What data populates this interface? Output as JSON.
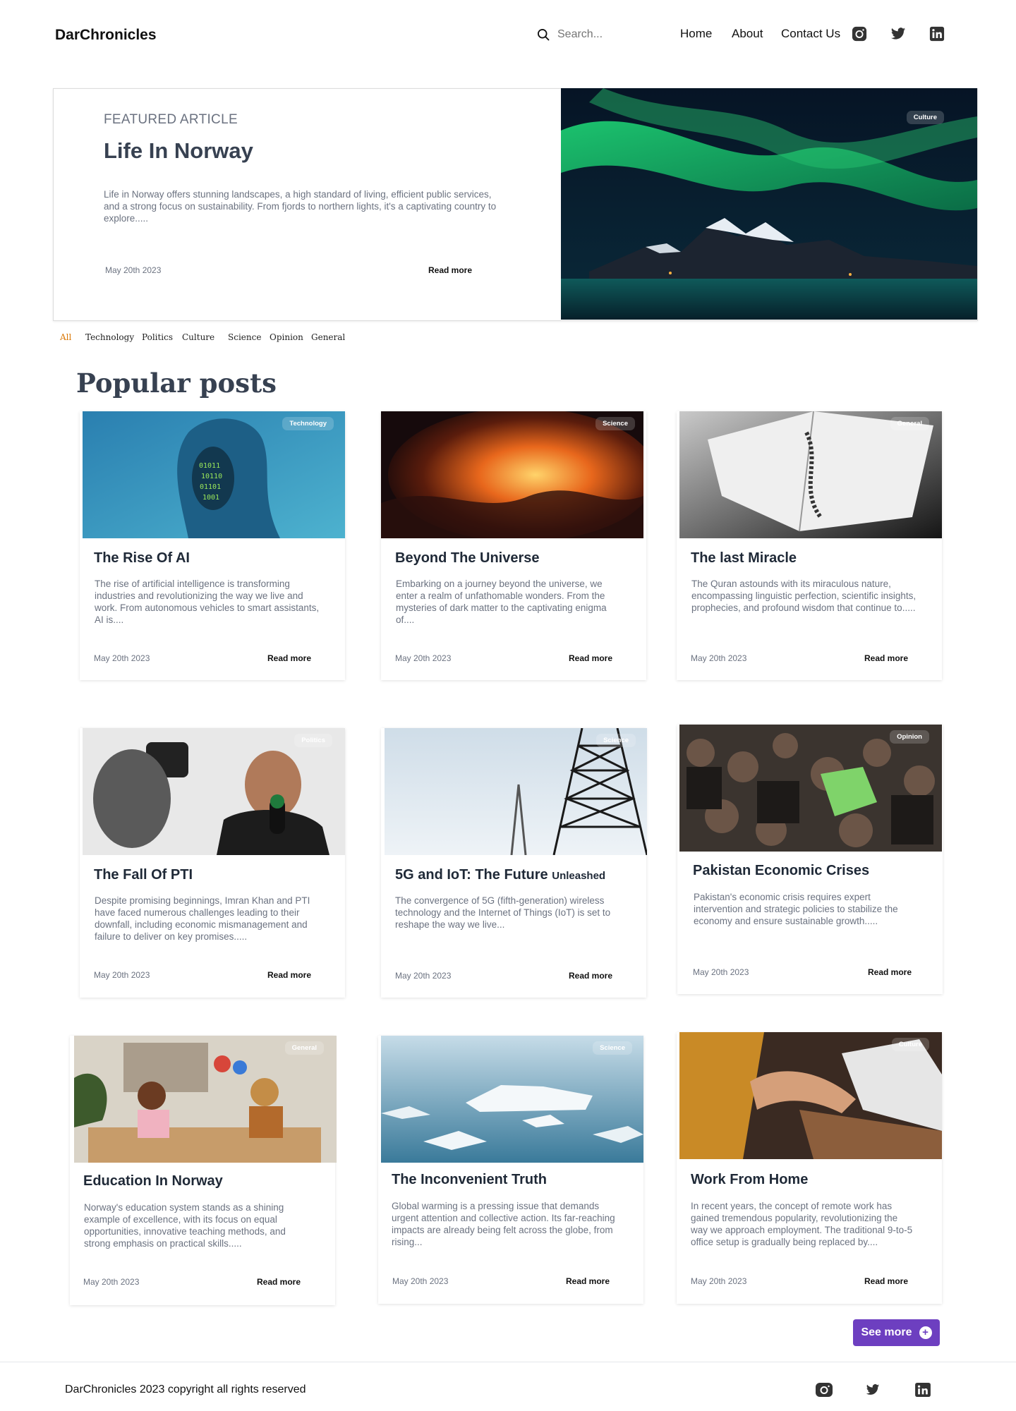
{
  "header": {
    "brand": "DarChronicles",
    "search_placeholder": "Search...",
    "nav": [
      "Home",
      "About",
      "Contact Us"
    ],
    "social_icons": [
      "instagram-icon",
      "twitter-icon",
      "linkedin-icon"
    ]
  },
  "featured": {
    "kicker": "FEATURED ARTICLE",
    "title": "Life In Norway",
    "description": "Life in Norway offers stunning landscapes, a high standard of living, efficient public services, and a strong focus on sustainability. From fjords to northern lights, it's a captivating country to explore.....",
    "date": "May 20th 2023",
    "read_more": "Read more",
    "badge": "Culture"
  },
  "categories": [
    "All",
    "Technology",
    "Politics",
    "Culture",
    "Science",
    "Opinion",
    "General"
  ],
  "active_category": "All",
  "section_title": "Popular posts",
  "posts": [
    {
      "badge": "Technology",
      "title": "The Rise Of AI",
      "title_suffix": "",
      "description": "The rise of artificial intelligence is transforming industries and revolutionizing the way we live and work. From autonomous vehicles to smart assistants, AI is....",
      "date": "May 20th 2023",
      "read_more": "Read more"
    },
    {
      "badge": "Science",
      "title": "Beyond The Universe",
      "title_suffix": "",
      "description": "Embarking on a journey beyond the universe, we enter a realm of unfathomable wonders. From the mysteries of dark matter to the captivating enigma of....",
      "date": "May 20th 2023",
      "read_more": "Read more"
    },
    {
      "badge": "General",
      "title": "The last Miracle",
      "title_suffix": "",
      "description": "The Quran astounds with its miraculous nature, encompassing linguistic perfection, scientific insights, prophecies, and profound wisdom that continue to.....",
      "date": "May 20th 2023",
      "read_more": "Read more"
    },
    {
      "badge": "Politics",
      "title": "The Fall Of PTI",
      "title_suffix": "",
      "description": "Despite promising beginnings, Imran Khan and PTI have faced numerous challenges leading to their downfall, including economic mismanagement and failure to deliver on key promises.....",
      "date": "May 20th 2023",
      "read_more": "Read more"
    },
    {
      "badge": "Science",
      "title": "5G and IoT: The Future",
      "title_suffix": "Unleashed",
      "description": "The convergence of 5G (fifth-generation) wireless technology and the Internet of Things (IoT) is set to reshape the way we live...",
      "date": "May 20th 2023",
      "read_more": "Read more"
    },
    {
      "badge": "Opinion",
      "title": "Pakistan Economic Crises",
      "title_suffix": "",
      "description": "Pakistan's economic crisis requires expert intervention and strategic policies to stabilize the economy and ensure sustainable growth.....",
      "date": "May 20th 2023",
      "read_more": "Read more"
    },
    {
      "badge": "General",
      "title": "Education In Norway",
      "title_suffix": "",
      "description": "Norway's education system stands as a shining example of excellence, with its focus on equal opportunities, innovative teaching methods, and strong emphasis on practical skills.....",
      "date": "May 20th 2023",
      "read_more": "Read more"
    },
    {
      "badge": "Science",
      "title": "The Inconvenient Truth",
      "title_suffix": "",
      "description": "Global warming is a pressing issue that demands urgent attention and collective action. Its far-reaching impacts are already being felt across the globe, from rising...",
      "date": "May 20th 2023",
      "read_more": "Read more"
    },
    {
      "badge": "Culture",
      "title": "Work From Home",
      "title_suffix": "",
      "description": "In recent years, the concept of remote work has gained tremendous popularity, revolutionizing the way we approach employment. The traditional 9-to-5 office setup is gradually being replaced by....",
      "date": "May 20th 2023",
      "read_more": "Read more"
    }
  ],
  "see_more": "See more",
  "footer": {
    "copyright": "DarChronicles 2023 copyright all rights reserved"
  },
  "colors": {
    "accent": "#6d3fc0",
    "active_category": "#d97706",
    "heading": "#374151",
    "muted_text": "#6b7280"
  }
}
